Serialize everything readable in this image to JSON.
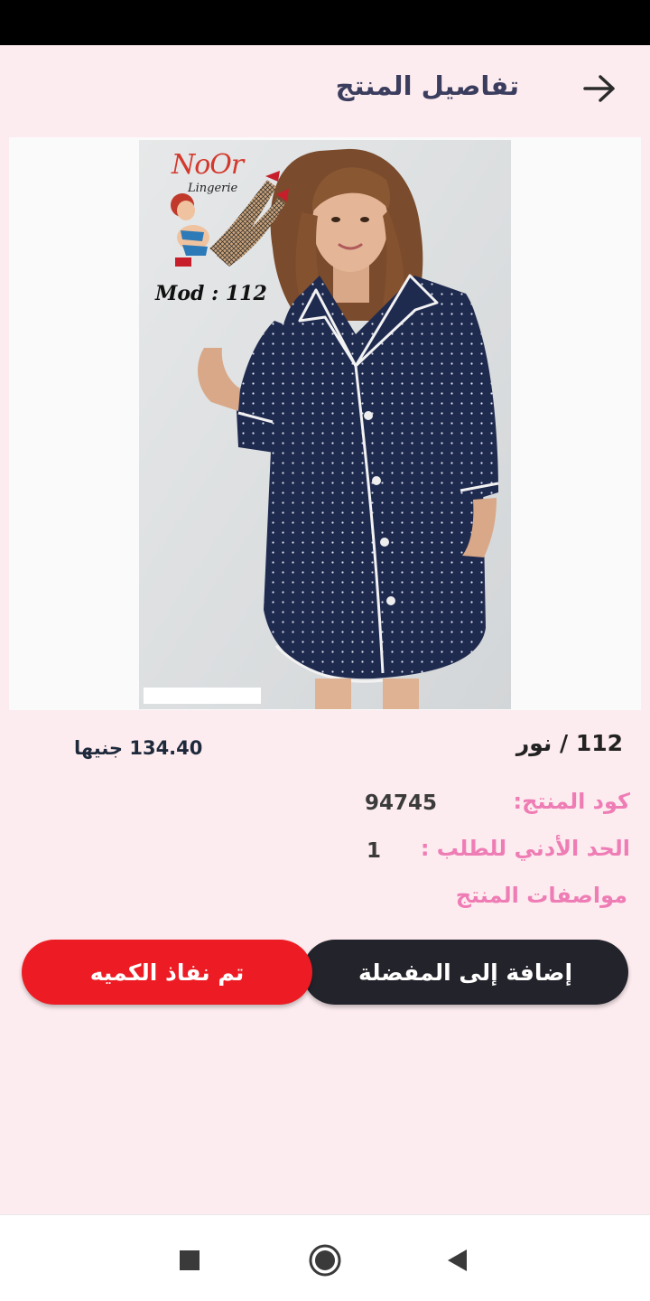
{
  "header": {
    "title": "تفاصيل المنتج",
    "back_icon": "arrow-right-icon"
  },
  "product": {
    "image_alt": "Navy polka dot button-up nightshirt with white piping",
    "logo_text": "NoOr",
    "logo_subtext": "Lingerie",
    "model_label": "Mod : 112",
    "name": "112 / نور",
    "price": "134.40 جنيها",
    "code_label": "كود المنتج:",
    "code_value": "94745",
    "min_order_label": "الحد الأدني للطلب :",
    "min_order_value": "1",
    "specs_label": "مواصفات المنتج"
  },
  "actions": {
    "add_to_favorites": "إضافة إلى المفضلة",
    "out_of_stock": "تم نفاذ الكميه"
  },
  "colors": {
    "background": "#fdecef",
    "title": "#3b3d5e",
    "label_pink": "#ef7db5",
    "dark_button": "#23232b",
    "red_button": "#ed1c24"
  },
  "nav": {
    "recents_icon": "square-icon",
    "home_icon": "circle-home-icon",
    "back_icon": "triangle-back-icon"
  }
}
